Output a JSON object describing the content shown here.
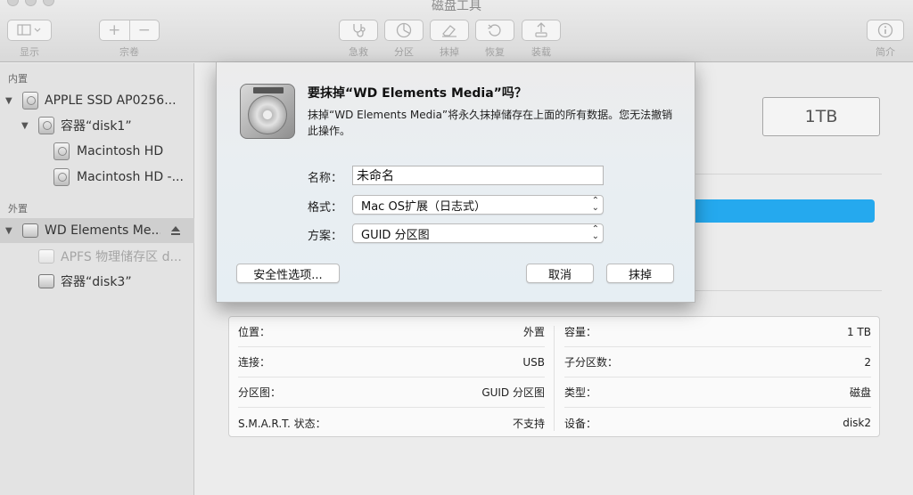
{
  "window": {
    "title": "磁盘工具"
  },
  "toolbar": {
    "view_label": "显示",
    "volume_label": "宗卷",
    "add": "+",
    "remove": "−",
    "first_aid": "急救",
    "partition": "分区",
    "erase": "抹掉",
    "restore": "恢复",
    "mount": "装载",
    "info": "简介"
  },
  "sidebar": {
    "internal_title": "内置",
    "external_title": "外置",
    "internal": [
      {
        "label": "APPLE SSD AP0256..."
      },
      {
        "label": "容器“disk1”"
      },
      {
        "label": "Macintosh HD"
      },
      {
        "label": "Macintosh HD -..."
      }
    ],
    "external": [
      {
        "label": "WD Elements Me..."
      },
      {
        "label": "APFS 物理储存区 d..."
      },
      {
        "label": "容器“disk3”"
      }
    ]
  },
  "main": {
    "capacity": "1TB",
    "info": {
      "left": [
        {
          "key": "位置：",
          "value": "外置"
        },
        {
          "key": "连接：",
          "value": "USB"
        },
        {
          "key": "分区图：",
          "value": "GUID 分区图"
        },
        {
          "key": "S.M.A.R.T. 状态：",
          "value": "不支持"
        }
      ],
      "right": [
        {
          "key": "容量：",
          "value": "1 TB"
        },
        {
          "key": "子分区数：",
          "value": "2"
        },
        {
          "key": "类型：",
          "value": "磁盘"
        },
        {
          "key": "设备：",
          "value": "disk2"
        }
      ]
    }
  },
  "dialog": {
    "title": "要抹掉“WD Elements Media”吗？",
    "message": "抹掉“WD Elements Media”将永久抹掉储存在上面的所有数据。您无法撤销此操作。",
    "name_label": "名称：",
    "name_value": "未命名",
    "format_label": "格式：",
    "format_value": "Mac OS扩展（日志式）",
    "scheme_label": "方案：",
    "scheme_value": "GUID 分区图",
    "security_button": "安全性选项...",
    "cancel_button": "取消",
    "erase_button": "抹掉"
  }
}
